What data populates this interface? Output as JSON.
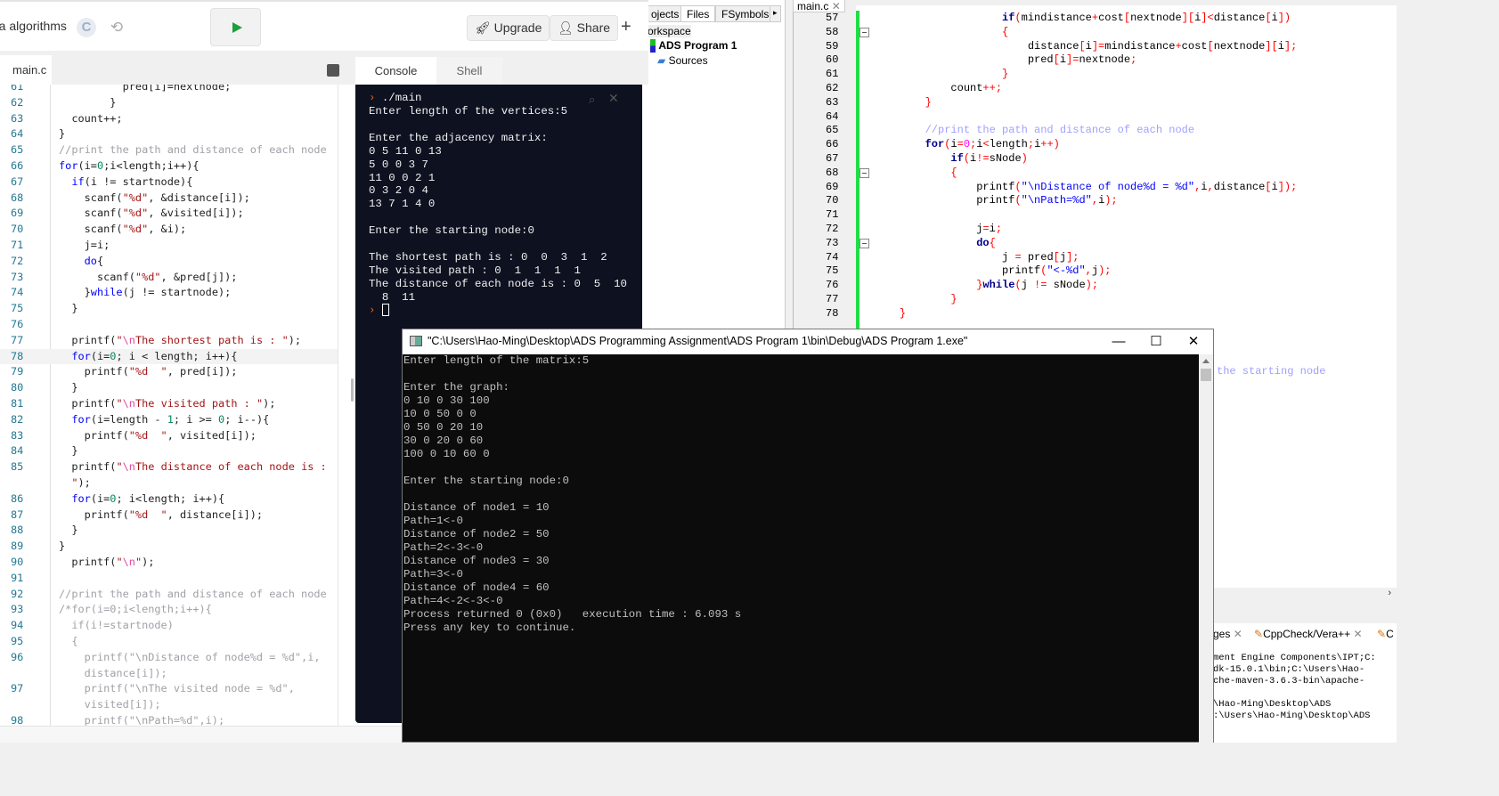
{
  "replit": {
    "title": "ra algorithms",
    "lang_badge": "C",
    "upgrade": "Upgrade",
    "share": "Share",
    "add": "+",
    "file_tab": "main.c",
    "console_tab": "Console",
    "shell_tab": "Shell",
    "editor_rows": [
      {
        "n": "61",
        "seg": [
          [
            "p",
            "          pred[i]=nextnode;"
          ]
        ]
      },
      {
        "n": "62",
        "seg": [
          [
            "p",
            "        }"
          ]
        ]
      },
      {
        "n": "63",
        "seg": [
          [
            "p",
            "  count++;"
          ]
        ]
      },
      {
        "n": "64",
        "seg": [
          [
            "p",
            "}"
          ]
        ]
      },
      {
        "n": "65",
        "seg": [
          [
            "c",
            "//print the path and distance of each node"
          ]
        ]
      },
      {
        "n": "66",
        "seg": [
          [
            "k",
            "for"
          ],
          [
            "p",
            "(i="
          ],
          [
            "n",
            "0"
          ],
          [
            "p",
            ";i<length;i++){"
          ]
        ]
      },
      {
        "n": "67",
        "seg": [
          [
            "p",
            "  "
          ],
          [
            "k",
            "if"
          ],
          [
            "p",
            "(i != startnode){"
          ]
        ]
      },
      {
        "n": "68",
        "seg": [
          [
            "p",
            "    scanf("
          ],
          [
            "s",
            "\"%d\""
          ],
          [
            "p",
            ", &distance[i]);"
          ]
        ]
      },
      {
        "n": "69",
        "seg": [
          [
            "p",
            "    scanf("
          ],
          [
            "s",
            "\"%d\""
          ],
          [
            "p",
            ", &visited[i]);"
          ]
        ]
      },
      {
        "n": "70",
        "seg": [
          [
            "p",
            "    scanf("
          ],
          [
            "s",
            "\"%d\""
          ],
          [
            "p",
            ", &i);"
          ]
        ]
      },
      {
        "n": "71",
        "seg": [
          [
            "p",
            "    j=i;"
          ]
        ]
      },
      {
        "n": "72",
        "seg": [
          [
            "p",
            "    "
          ],
          [
            "k",
            "do"
          ],
          [
            "p",
            "{"
          ]
        ]
      },
      {
        "n": "73",
        "seg": [
          [
            "p",
            "      scanf("
          ],
          [
            "s",
            "\"%d\""
          ],
          [
            "p",
            ", &pred[j]);"
          ]
        ]
      },
      {
        "n": "74",
        "seg": [
          [
            "p",
            "    }"
          ],
          [
            "k",
            "while"
          ],
          [
            "p",
            "(j != startnode);"
          ]
        ]
      },
      {
        "n": "75",
        "seg": [
          [
            "p",
            "  }"
          ]
        ]
      },
      {
        "n": "76",
        "seg": []
      },
      {
        "n": "77",
        "seg": [
          [
            "p",
            "  printf("
          ],
          [
            "s",
            "\""
          ],
          [
            "e",
            "\\n"
          ],
          [
            "s",
            "The shortest path is : \""
          ],
          [
            "p",
            ");"
          ]
        ]
      },
      {
        "n": "78",
        "hl": true,
        "seg": [
          [
            "p",
            "  "
          ],
          [
            "k",
            "for"
          ],
          [
            "p",
            "(i="
          ],
          [
            "n",
            "0"
          ],
          [
            "p",
            "; i < length; i++){"
          ]
        ]
      },
      {
        "n": "79",
        "seg": [
          [
            "p",
            "    printf("
          ],
          [
            "s",
            "\"%d  \""
          ],
          [
            "p",
            ", pred[i]);"
          ]
        ]
      },
      {
        "n": "80",
        "seg": [
          [
            "p",
            "  }"
          ]
        ]
      },
      {
        "n": "81",
        "seg": [
          [
            "p",
            "  printf("
          ],
          [
            "s",
            "\""
          ],
          [
            "e",
            "\\n"
          ],
          [
            "s",
            "The visited path : \""
          ],
          [
            "p",
            ");"
          ]
        ]
      },
      {
        "n": "82",
        "seg": [
          [
            "p",
            "  "
          ],
          [
            "k",
            "for"
          ],
          [
            "p",
            "(i=length - "
          ],
          [
            "n",
            "1"
          ],
          [
            "p",
            "; i >= "
          ],
          [
            "n",
            "0"
          ],
          [
            "p",
            "; i--){"
          ]
        ]
      },
      {
        "n": "83",
        "seg": [
          [
            "p",
            "    printf("
          ],
          [
            "s",
            "\"%d  \""
          ],
          [
            "p",
            ", visited[i]);"
          ]
        ]
      },
      {
        "n": "84",
        "seg": [
          [
            "p",
            "  }"
          ]
        ]
      },
      {
        "n": "85",
        "seg": [
          [
            "p",
            "  printf("
          ],
          [
            "s",
            "\""
          ],
          [
            "e",
            "\\n"
          ],
          [
            "s",
            "The distance of each node is :"
          ]
        ]
      },
      {
        "n": "",
        "seg": [
          [
            "s",
            "  \""
          ],
          [
            "p",
            ");"
          ]
        ]
      },
      {
        "n": "86",
        "seg": [
          [
            "p",
            "  "
          ],
          [
            "k",
            "for"
          ],
          [
            "p",
            "(i="
          ],
          [
            "n",
            "0"
          ],
          [
            "p",
            "; i<length; i++){"
          ]
        ]
      },
      {
        "n": "87",
        "seg": [
          [
            "p",
            "    printf("
          ],
          [
            "s",
            "\"%d  \""
          ],
          [
            "p",
            ", distance[i]);"
          ]
        ]
      },
      {
        "n": "88",
        "seg": [
          [
            "p",
            "  }"
          ]
        ]
      },
      {
        "n": "89",
        "seg": [
          [
            "p",
            "}"
          ]
        ]
      },
      {
        "n": "90",
        "seg": [
          [
            "p",
            "  printf("
          ],
          [
            "s",
            "\""
          ],
          [
            "e",
            "\\n"
          ],
          [
            "s",
            "\""
          ],
          [
            "p",
            ");"
          ]
        ]
      },
      {
        "n": "91",
        "seg": []
      },
      {
        "n": "92",
        "seg": [
          [
            "c",
            "//print the path and distance of each node"
          ]
        ]
      },
      {
        "n": "93",
        "seg": [
          [
            "c",
            "/*for(i=0;i<length;i++){"
          ]
        ]
      },
      {
        "n": "94",
        "seg": [
          [
            "c",
            "  if(i!=startnode)"
          ]
        ]
      },
      {
        "n": "95",
        "seg": [
          [
            "c",
            "  {"
          ]
        ]
      },
      {
        "n": "96",
        "seg": [
          [
            "c",
            "    printf(\"\\nDistance of node%d = %d\",i,"
          ]
        ]
      },
      {
        "n": "",
        "seg": [
          [
            "c",
            "    distance[i]);"
          ]
        ]
      },
      {
        "n": "97",
        "seg": [
          [
            "c",
            "    printf(\"\\nThe visited node = %d\","
          ]
        ]
      },
      {
        "n": "",
        "seg": [
          [
            "c",
            "    visited[i]);"
          ]
        ]
      },
      {
        "n": "98",
        "seg": [
          [
            "c",
            "    printf(\"\\nPath=%d\",i);"
          ]
        ]
      }
    ],
    "console_prompt": "./main",
    "console_lines": [
      "Enter length of the vertices:5",
      "",
      "Enter the adjacency matrix:",
      "0 5 11 0 13",
      "5 0 0 3 7",
      "11 0 0 2 1",
      "0 3 2 0 4",
      "13 7 1 4 0",
      "",
      "Enter the starting node:0",
      "",
      "The shortest path is : 0  0  3  1  2",
      "The visited path : 0  1  1  1  1",
      "The distance of each node is : 0  5  10",
      "  8  11"
    ]
  },
  "codeblocks": {
    "tabs": [
      "ojects",
      "Files",
      "FSymbols"
    ],
    "tree": {
      "workspace": "orkspace",
      "project": "ADS Program 1",
      "sources": "Sources"
    },
    "editor_tab": "main.c",
    "rows": [
      {
        "n": "57",
        "seg": [
          [
            "p",
            "                    "
          ],
          [
            "k",
            "if"
          ],
          [
            "o",
            "("
          ],
          [
            "p",
            "mindistance"
          ],
          [
            "o",
            "+"
          ],
          [
            "p",
            "cost"
          ],
          [
            "o",
            "["
          ],
          [
            "p",
            "nextnode"
          ],
          [
            "o",
            "]["
          ],
          [
            "p",
            "i"
          ],
          [
            "o",
            "]<"
          ],
          [
            "p",
            "distance"
          ],
          [
            "o",
            "["
          ],
          [
            "p",
            "i"
          ],
          [
            "o",
            "])"
          ]
        ]
      },
      {
        "n": "58",
        "fold": true,
        "seg": [
          [
            "p",
            "                    "
          ],
          [
            "o",
            "{"
          ]
        ]
      },
      {
        "n": "59",
        "seg": [
          [
            "p",
            "                        distance"
          ],
          [
            "o",
            "["
          ],
          [
            "p",
            "i"
          ],
          [
            "o",
            "]="
          ],
          [
            "p",
            "mindistance"
          ],
          [
            "o",
            "+"
          ],
          [
            "p",
            "cost"
          ],
          [
            "o",
            "["
          ],
          [
            "p",
            "nextnode"
          ],
          [
            "o",
            "]["
          ],
          [
            "p",
            "i"
          ],
          [
            "o",
            "];"
          ]
        ]
      },
      {
        "n": "60",
        "seg": [
          [
            "p",
            "                        pred"
          ],
          [
            "o",
            "["
          ],
          [
            "p",
            "i"
          ],
          [
            "o",
            "]="
          ],
          [
            "p",
            "nextnode"
          ],
          [
            "o",
            ";"
          ]
        ]
      },
      {
        "n": "61",
        "seg": [
          [
            "p",
            "                    "
          ],
          [
            "o",
            "}"
          ]
        ]
      },
      {
        "n": "62",
        "seg": [
          [
            "p",
            "            count"
          ],
          [
            "o",
            "++;"
          ]
        ]
      },
      {
        "n": "63",
        "seg": [
          [
            "p",
            "        "
          ],
          [
            "o",
            "}"
          ]
        ]
      },
      {
        "n": "64",
        "seg": []
      },
      {
        "n": "65",
        "seg": [
          [
            "p",
            "        "
          ],
          [
            "c",
            "//print the path and distance of each node"
          ]
        ]
      },
      {
        "n": "66",
        "seg": [
          [
            "p",
            "        "
          ],
          [
            "k",
            "for"
          ],
          [
            "o",
            "("
          ],
          [
            "p",
            "i"
          ],
          [
            "o",
            "="
          ],
          [
            "n",
            "0"
          ],
          [
            "o",
            ";"
          ],
          [
            "p",
            "i"
          ],
          [
            "o",
            "<"
          ],
          [
            "p",
            "length"
          ],
          [
            "o",
            ";"
          ],
          [
            "p",
            "i"
          ],
          [
            "o",
            "++)"
          ]
        ]
      },
      {
        "n": "67",
        "seg": [
          [
            "p",
            "            "
          ],
          [
            "k",
            "if"
          ],
          [
            "o",
            "("
          ],
          [
            "p",
            "i"
          ],
          [
            "o",
            "!="
          ],
          [
            "p",
            "sNode"
          ],
          [
            "o",
            ")"
          ]
        ]
      },
      {
        "n": "68",
        "fold": true,
        "seg": [
          [
            "p",
            "            "
          ],
          [
            "o",
            "{"
          ]
        ]
      },
      {
        "n": "69",
        "seg": [
          [
            "p",
            "                printf"
          ],
          [
            "o",
            "("
          ],
          [
            "s",
            "\"\\nDistance of node%d = %d\""
          ],
          [
            "o",
            ","
          ],
          [
            "p",
            "i"
          ],
          [
            "o",
            ","
          ],
          [
            "p",
            "distance"
          ],
          [
            "o",
            "["
          ],
          [
            "p",
            "i"
          ],
          [
            "o",
            "]);"
          ]
        ]
      },
      {
        "n": "70",
        "seg": [
          [
            "p",
            "                printf"
          ],
          [
            "o",
            "("
          ],
          [
            "s",
            "\"\\nPath=%d\""
          ],
          [
            "o",
            ","
          ],
          [
            "p",
            "i"
          ],
          [
            "o",
            ");"
          ]
        ]
      },
      {
        "n": "71",
        "seg": []
      },
      {
        "n": "72",
        "seg": [
          [
            "p",
            "                j"
          ],
          [
            "o",
            "="
          ],
          [
            "p",
            "i"
          ],
          [
            "o",
            ";"
          ]
        ]
      },
      {
        "n": "73",
        "fold": true,
        "seg": [
          [
            "p",
            "                "
          ],
          [
            "k",
            "do"
          ],
          [
            "o",
            "{"
          ]
        ]
      },
      {
        "n": "74",
        "seg": [
          [
            "p",
            "                    j "
          ],
          [
            "o",
            "="
          ],
          [
            "p",
            " pred"
          ],
          [
            "o",
            "["
          ],
          [
            "p",
            "j"
          ],
          [
            "o",
            "];"
          ]
        ]
      },
      {
        "n": "75",
        "seg": [
          [
            "p",
            "                    printf"
          ],
          [
            "o",
            "("
          ],
          [
            "s",
            "\"<-%d\""
          ],
          [
            "o",
            ","
          ],
          [
            "p",
            "j"
          ],
          [
            "o",
            ");"
          ]
        ]
      },
      {
        "n": "76",
        "seg": [
          [
            "p",
            "                "
          ],
          [
            "o",
            "}"
          ],
          [
            "k",
            "while"
          ],
          [
            "o",
            "("
          ],
          [
            "p",
            "j "
          ],
          [
            "o",
            "!="
          ],
          [
            "p",
            " sNode"
          ],
          [
            "o",
            ");"
          ]
        ]
      },
      {
        "n": "77",
        "seg": [
          [
            "p",
            "            "
          ],
          [
            "o",
            "}"
          ]
        ]
      },
      {
        "n": "78",
        "seg": [
          [
            "p",
            "    "
          ],
          [
            "o",
            "}"
          ]
        ]
      }
    ],
    "fragment": "the starting node",
    "bottom_tabs": [
      "ges",
      "CppCheck/Vera++",
      "C"
    ],
    "log": [
      "ment Engine Components\\IPT;C:",
      "dk-15.0.1\\bin;C:\\Users\\Hao-",
      "che-maven-3.6.3-bin\\apache-",
      "",
      "\\Hao-Ming\\Desktop\\ADS",
      ":\\Users\\Hao-Ming\\Desktop\\ADS"
    ]
  },
  "exe": {
    "title": "\"C:\\Users\\Hao-Ming\\Desktop\\ADS Programming Assignment\\ADS Program 1\\bin\\Debug\\ADS Program 1.exe\"",
    "lines": [
      "Enter length of the matrix:5",
      "",
      "Enter the graph:",
      "0 10 0 30 100",
      "10 0 50 0 0",
      "0 50 0 20 10",
      "30 0 20 0 60",
      "100 0 10 60 0",
      "",
      "Enter the starting node:0",
      "",
      "Distance of node1 = 10",
      "Path=1<-0",
      "Distance of node2 = 50",
      "Path=2<-3<-0",
      "Distance of node3 = 30",
      "Path=3<-0",
      "Distance of node4 = 60",
      "Path=4<-2<-3<-0",
      "Process returned 0 (0x0)   execution time : 6.093 s",
      "Press any key to continue."
    ]
  },
  "colors": {
    "run": "#1e9e3e",
    "console_bg": "#0e1120",
    "cb_change_bar": "#22dd44",
    "exe_bg": "#0c0c0c"
  }
}
